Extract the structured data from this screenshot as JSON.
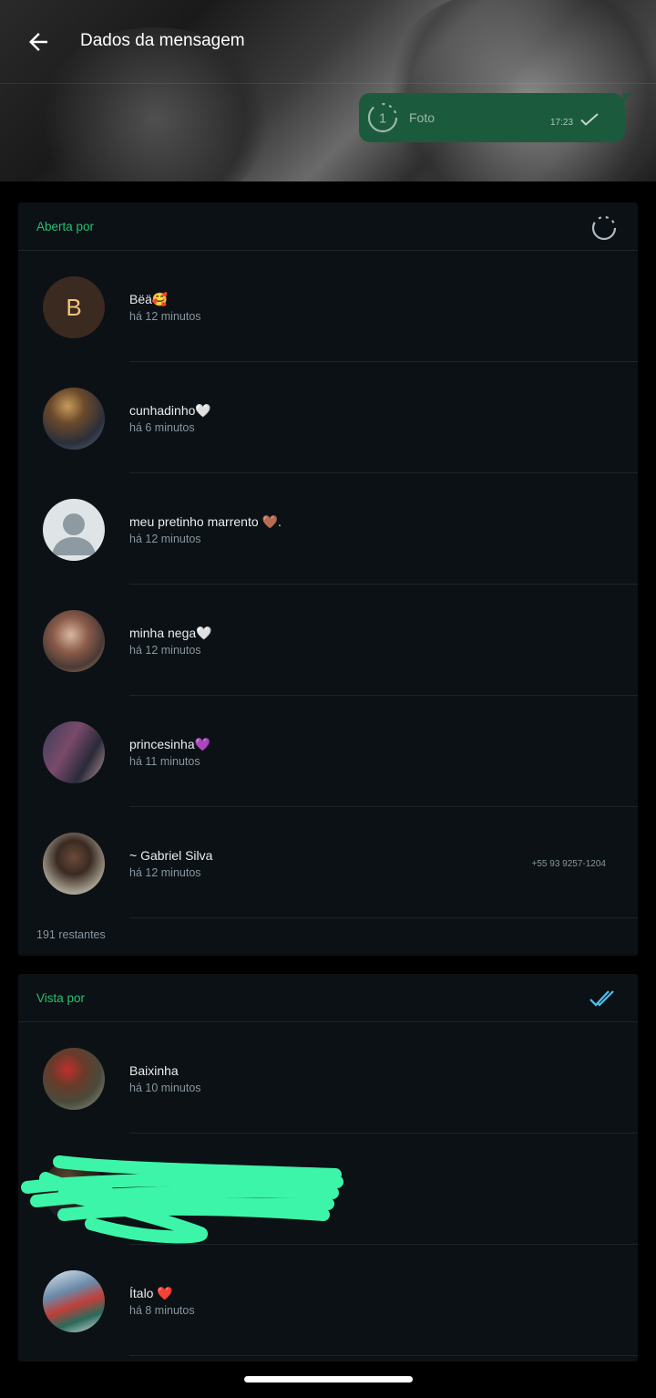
{
  "header": {
    "title": "Dados da mensagem",
    "message": {
      "label": "Foto",
      "time": "17:23",
      "view_once_number": "1"
    }
  },
  "opened_by": {
    "label": "Aberta por",
    "icon": "view-once-opened-icon",
    "contacts": [
      {
        "name": "Bëä🥰",
        "time": "há 12 minutos",
        "avatar_letter": "B"
      },
      {
        "name": "cunhadinho🤍",
        "time": "há 6 minutos"
      },
      {
        "name": "meu pretinho marrento 🤎.",
        "time": "há 12 minutos"
      },
      {
        "name": "minha nega🤍",
        "time": "há 12 minutos"
      },
      {
        "name": "princesinha💜",
        "time": "há 11 minutos"
      },
      {
        "name": "~ Gabriel Silva",
        "time": "há 12 minutos",
        "phone": "+55 93 9257-1204"
      }
    ],
    "remaining": "191 restantes"
  },
  "seen_by": {
    "label": "Vista por",
    "icon": "double-check-icon",
    "contacts": [
      {
        "name": "Baixinha",
        "time": "há 10 minutos"
      },
      {
        "name": "",
        "time": ""
      },
      {
        "name": "Ítalo ❤️",
        "time": "há 8 minutos"
      }
    ]
  },
  "colors": {
    "accent_green": "#25c16f",
    "bubble": "#1c5a3d",
    "card_bg": "#0c1115",
    "read_blue": "#53bdeb",
    "scribble": "#3df5a8"
  }
}
